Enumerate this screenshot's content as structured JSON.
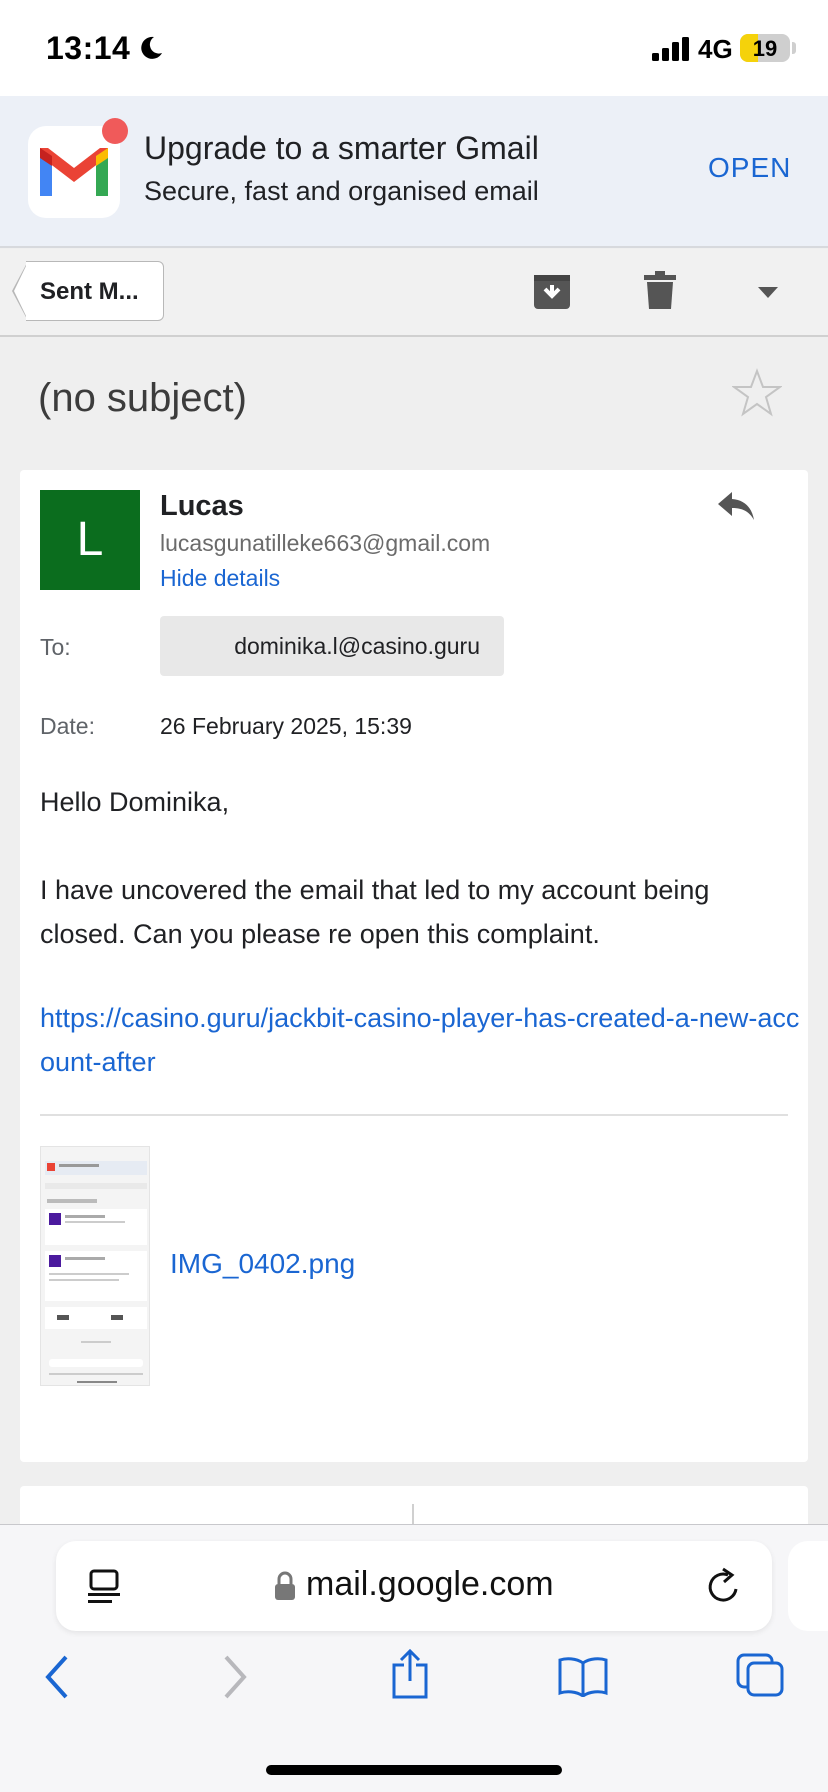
{
  "status_bar": {
    "time": "13:14",
    "network": "4G",
    "battery": "19"
  },
  "promo": {
    "title": "Upgrade to a smarter Gmail",
    "subtitle": "Secure, fast and organised email",
    "open_label": "OPEN"
  },
  "toolbar": {
    "back_label": "Sent M..."
  },
  "email": {
    "subject": "(no subject)",
    "sender_initial": "L",
    "sender_name": "Lucas",
    "sender_email": "lucasgunatilleke663@gmail.com",
    "hide_details": "Hide details",
    "to_label": "To:",
    "to_value": "dominika.l@casino.guru",
    "date_label": "Date:",
    "date_value": "26 February 2025, 15:39",
    "greeting": "Hello Dominika,",
    "body": "I have uncovered the email that led to my account being closed. Can you please re open this complaint.",
    "link": "https://casino.guru/jackbit-casino-player-has-created-a-new-account-after",
    "attachment_name": "IMG_0402.png"
  },
  "browser": {
    "url": "mail.google.com"
  },
  "colors": {
    "link": "#1a66d2",
    "avatar": "#0b6d1e",
    "promo_bg": "#ecf0f7"
  }
}
